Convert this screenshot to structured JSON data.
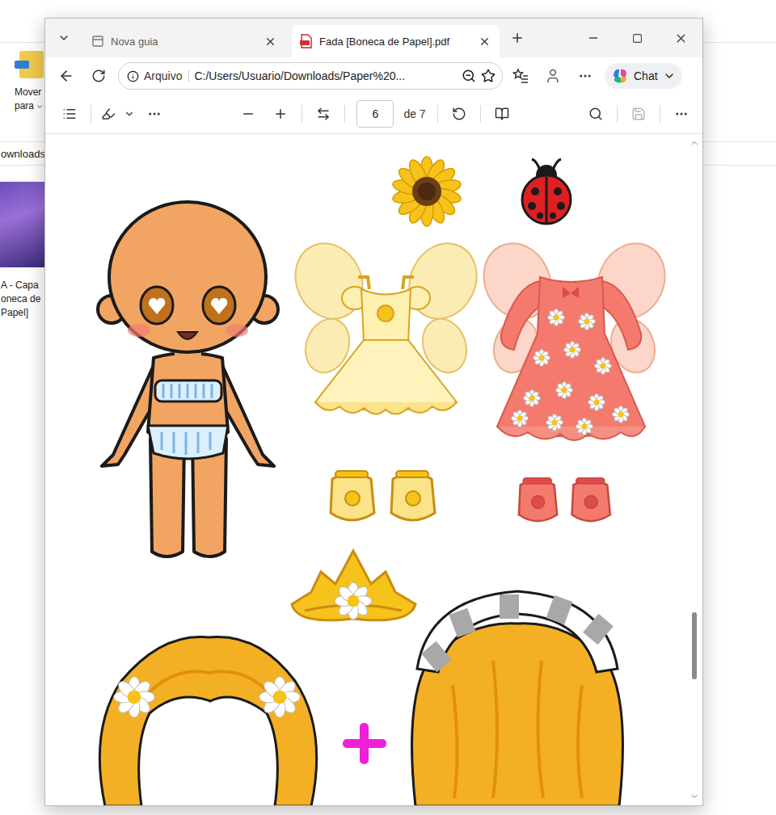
{
  "explorer": {
    "ribbon_button": [
      "Mover",
      "para"
    ],
    "address": "ownloads",
    "file": {
      "caption": [
        "A  - Capa",
        "oneca de",
        "Papel]"
      ]
    }
  },
  "tabs": [
    {
      "label": "Nova guia",
      "selected": false,
      "kind": "page"
    },
    {
      "label": "Fada [Boneca de Papel].pdf",
      "selected": true,
      "kind": "pdf"
    }
  ],
  "address_bar": {
    "scheme": "Arquivo",
    "url": "C:/Users/Usuario/Downloads/Paper%20..."
  },
  "chat_button": {
    "label": "Chat"
  },
  "pdf_toolbar": {
    "page": "6",
    "page_total": "de 7",
    "save_enabled": false
  },
  "scrollbar": {
    "position": 0.81
  }
}
